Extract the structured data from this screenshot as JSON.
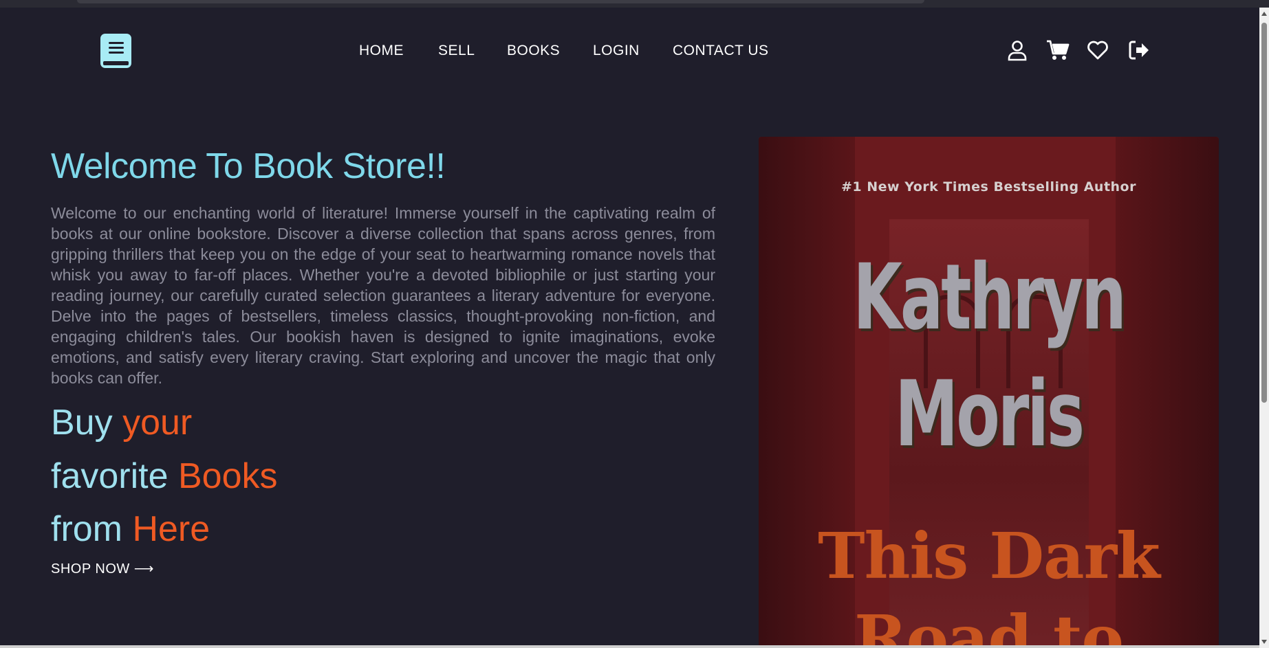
{
  "nav": {
    "items": [
      "HOME",
      "SELL",
      "BOOKS",
      "LOGIN",
      "CONTACT US"
    ]
  },
  "header_icons": [
    "user-icon",
    "cart-icon",
    "heart-icon",
    "logout-icon"
  ],
  "hero": {
    "title": "Welcome To Book Store!!",
    "description": "Welcome to our enchanting world of literature! Immerse yourself in the captivating realm of books at our online bookstore. Discover a diverse collection that spans across genres, from gripping thrillers that keep you on the edge of your seat to heartwarming romance novels that whisk you away to far-off places. Whether you're a devoted bibliophile or just starting your reading journey, our carefully curated selection guarantees a literary adventure for everyone. Delve into the pages of bestsellers, timeless classics, thought-provoking non-fiction, and engaging children's tales. Our bookish haven is designed to ignite imaginations, evoke emotions, and satisfy every literary craving. Start exploring and uncover the magic that only books can offer.",
    "tagline": [
      {
        "plain": "Buy",
        "accent": "your"
      },
      {
        "plain": "favorite",
        "accent": "Books"
      },
      {
        "plain": "from",
        "accent": "Here"
      }
    ],
    "cta": "SHOP NOW ⟶"
  },
  "cover": {
    "top_line": "#1 New York Times Bestselling Author",
    "author_first": "Kathryn",
    "author_last": "Moris",
    "title_line1": "This Dark",
    "title_line2": "Road to"
  },
  "colors": {
    "background": "#1f1e2b",
    "accent_cyan": "#7fd8ea",
    "accent_orange": "#ef5a23",
    "logo": "#a8ecf5"
  }
}
